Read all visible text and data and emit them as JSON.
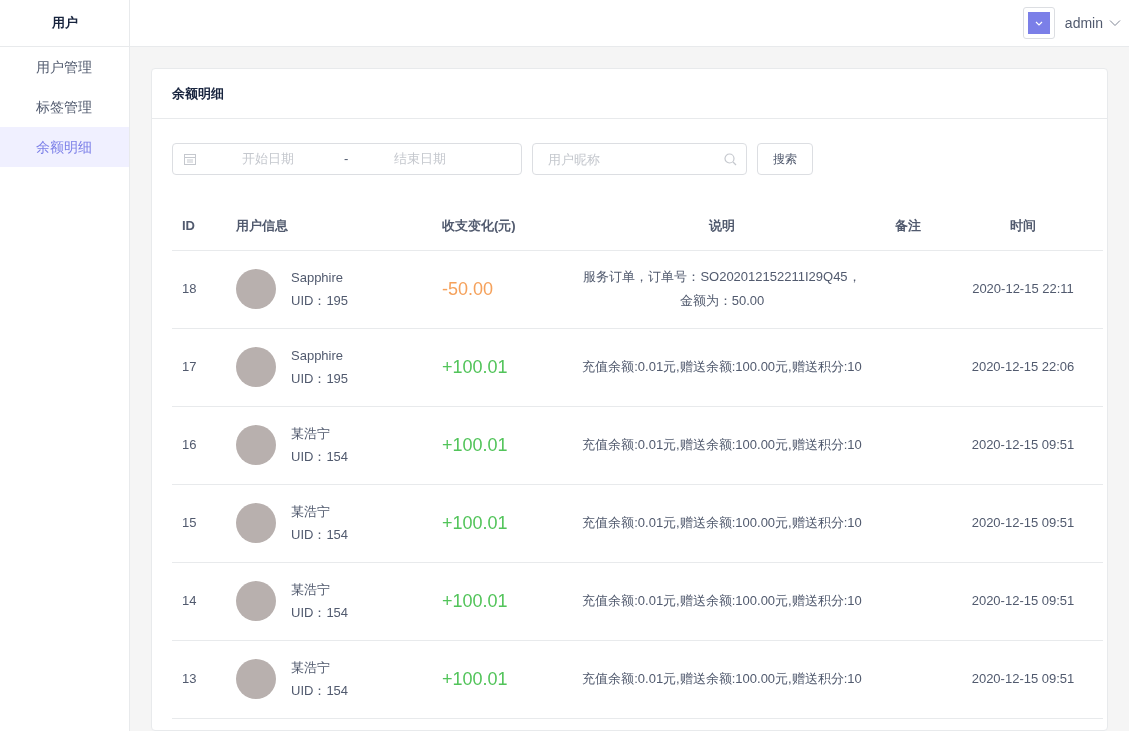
{
  "sidebar": {
    "title": "用户",
    "items": [
      {
        "label": "用户管理",
        "selected": false
      },
      {
        "label": "标签管理",
        "selected": false
      },
      {
        "label": "余额明细",
        "selected": true
      }
    ]
  },
  "header": {
    "user": "admin"
  },
  "card": {
    "title": "余额明细"
  },
  "filters": {
    "start_placeholder": "开始日期",
    "separator": "-",
    "end_placeholder": "结束日期",
    "nickname_placeholder": "用户昵称",
    "search_button": "搜索"
  },
  "table": {
    "columns": [
      "ID",
      "用户信息",
      "收支变化(元)",
      "说明",
      "备注",
      "时间"
    ],
    "rows": [
      {
        "id": "18",
        "name": "Sapphire",
        "uid": "UID：195",
        "amount": "-50.00",
        "kind": "expense",
        "description": "服务订单，订单号：SO202012152211I29Q45，金额为：50.00",
        "time": "2020-12-15 22:11"
      },
      {
        "id": "17",
        "name": "Sapphire",
        "uid": "UID：195",
        "amount": "+100.01",
        "kind": "income",
        "description": "充值余额:0.01元,赠送余额:100.00元,赠送积分:10",
        "time": "2020-12-15 22:06"
      },
      {
        "id": "16",
        "name": "某浩宁",
        "uid": "UID：154",
        "amount": "+100.01",
        "kind": "income",
        "description": "充值余额:0.01元,赠送余额:100.00元,赠送积分:10",
        "time": "2020-12-15 09:51"
      },
      {
        "id": "15",
        "name": "某浩宁",
        "uid": "UID：154",
        "amount": "+100.01",
        "kind": "income",
        "description": "充值余额:0.01元,赠送余额:100.00元,赠送积分:10",
        "time": "2020-12-15 09:51"
      },
      {
        "id": "14",
        "name": "某浩宁",
        "uid": "UID：154",
        "amount": "+100.01",
        "kind": "income",
        "description": "充值余额:0.01元,赠送余额:100.00元,赠送积分:10",
        "time": "2020-12-15 09:51"
      },
      {
        "id": "13",
        "name": "某浩宁",
        "uid": "UID：154",
        "amount": "+100.01",
        "kind": "income",
        "description": "充值余额:0.01元,赠送余额:100.00元,赠送积分:10",
        "time": "2020-12-15 09:51"
      }
    ]
  }
}
